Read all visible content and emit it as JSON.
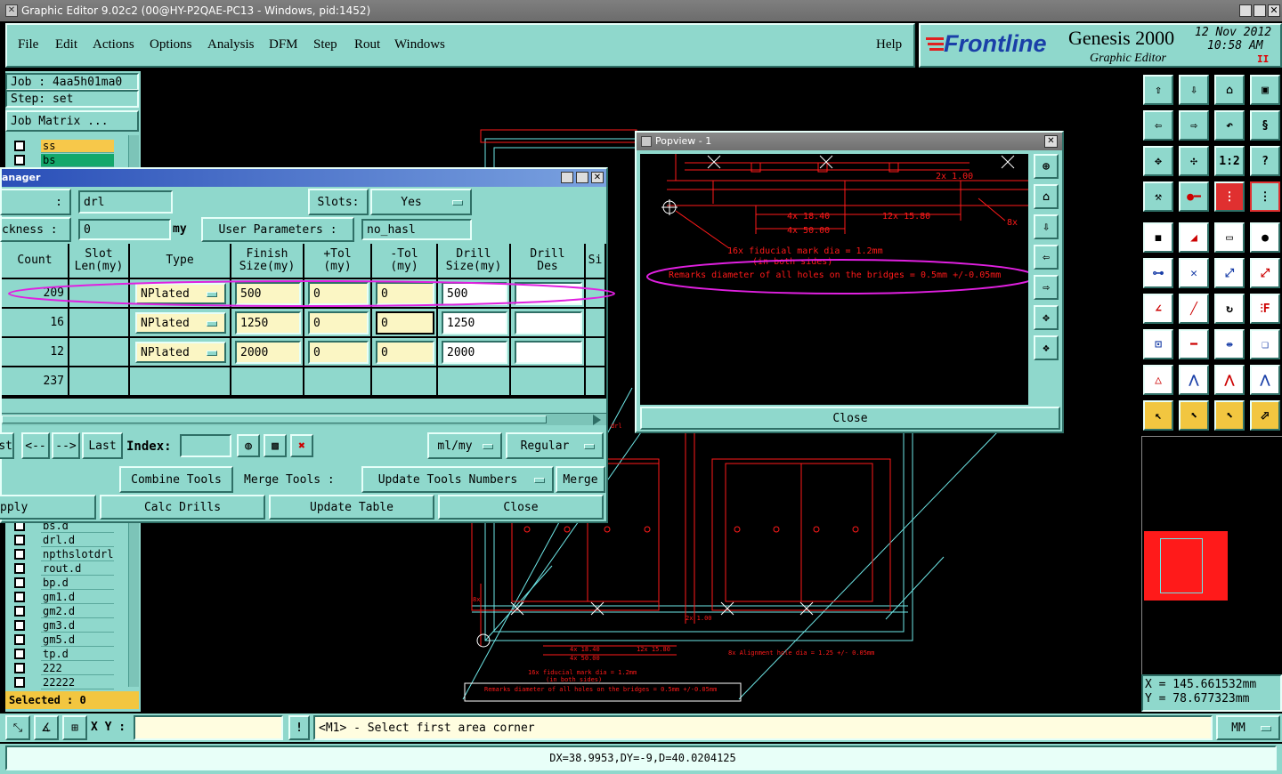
{
  "window": {
    "title": "Graphic Editor 9.02c2 (00@HY-P2QAE-PC13 - Windows, pid:1452)"
  },
  "menu": {
    "items": [
      "File",
      "Edit",
      "Actions",
      "Options",
      "Analysis",
      "DFM",
      "Step",
      "Rout",
      "Windows"
    ],
    "help": "Help"
  },
  "brand": {
    "logo": "Frontline",
    "product": "Genesis 2000",
    "subtitle": "Graphic Editor",
    "date": "12 Nov 2012",
    "time": "10:58 AM",
    "pause": "II"
  },
  "job": {
    "job": "Job : 4aa5h01ma0",
    "step": "Step: set",
    "matrix_button": "Job Matrix ..."
  },
  "layers_top": [
    {
      "name": "ss",
      "color": "#f7c84a"
    },
    {
      "name": "bs",
      "color": "#14a86b"
    }
  ],
  "layers_bottom": [
    "bs.d",
    "drl.d",
    "npthslotdrl",
    "rout.d",
    "bp.d",
    "gm1.d",
    "gm2.d",
    "gm3.d",
    "gm5.d",
    "tp.d",
    "222",
    "22222"
  ],
  "selected": "Selected : 0",
  "manager": {
    "title": "anager",
    "row1_label": ":",
    "layer_value": "drl",
    "slots_label": "Slots:",
    "slots_value": "Yes",
    "thickness_label": "ckness :",
    "thickness_value": "0",
    "thickness_unit": "my",
    "user_params_label": "User Parameters :",
    "user_params_value": "no_hasl",
    "headers": [
      "Count",
      "Slot\nLen(my)",
      "Type",
      "Finish\nSize(my)",
      "+Tol\n(my)",
      "-Tol\n(my)",
      "Drill\nSize(my)",
      "Drill\nDes",
      "Si"
    ],
    "rows": [
      {
        "count": "209",
        "type": "NPlated",
        "finish": "500",
        "ptol": "0",
        "mtol": "0",
        "drill": "500",
        "des": ""
      },
      {
        "count": "16",
        "type": "NPlated",
        "finish": "1250",
        "ptol": "0",
        "mtol": "0",
        "drill": "1250",
        "des": ""
      },
      {
        "count": "12",
        "type": "NPlated",
        "finish": "2000",
        "ptol": "0",
        "mtol": "0",
        "drill": "2000",
        "des": ""
      }
    ],
    "total": "237",
    "nav": {
      "first": "st",
      "prev": "<--",
      "next": "-->",
      "last": "Last",
      "index_label": "Index:",
      "index_value": "",
      "units": "ml/my",
      "mode": "Regular"
    },
    "combine": "Combine Tools",
    "merge_label": "Merge Tools :",
    "update_numbers": "Update Tools Numbers",
    "merge": "Merge",
    "apply": "pply",
    "calc": "Calc Drills",
    "update_table": "Update Table",
    "close": "Close"
  },
  "popview": {
    "title": "Popview - 1",
    "close": "Close",
    "dims": {
      "a": "4x 18.40",
      "b": "12x 15.80",
      "c": "4x 50.00",
      "d": "2x 1.00",
      "e": "8x",
      "f": "16x fiducial mark dia = 1.2mm",
      "g": "(in both sides)",
      "remark": "Remarks diameter of all holes on the bridges = 0.5mm +/-0.05mm"
    }
  },
  "canvas": {
    "dims": {
      "a": "4x 18.40",
      "b": "12x 15.80",
      "c": "4x 50.00",
      "d": "2x 1.00",
      "e": "8x Alignment hole dia = 1.25 +/- 0.05mm",
      "f": "16x fiducial mark dia = 1.2mm",
      "g": "(in both sides)",
      "remark": "Remarks diameter of all holes on the bridges = 0.5mm +/-0.05mm",
      "h": "8x",
      "i": "drl"
    }
  },
  "toolbar": {
    "labels": {
      "r1": "1:2",
      "r2": "?"
    }
  },
  "coords": {
    "x": "X = 145.661532mm",
    "y": "Y = 78.677323mm"
  },
  "command": {
    "xy_label": "X Y :",
    "xy_value": "",
    "warn": "!",
    "message": "<M1> - Select first area corner",
    "units": "MM"
  },
  "status": {
    "text": "DX=38.9953,DY=-9,D=40.0204125"
  },
  "colors": {
    "teal": "#8fd8cc",
    "red": "#ff1a1a",
    "cyan": "#6ee7e7",
    "magenta": "#e020e0"
  }
}
